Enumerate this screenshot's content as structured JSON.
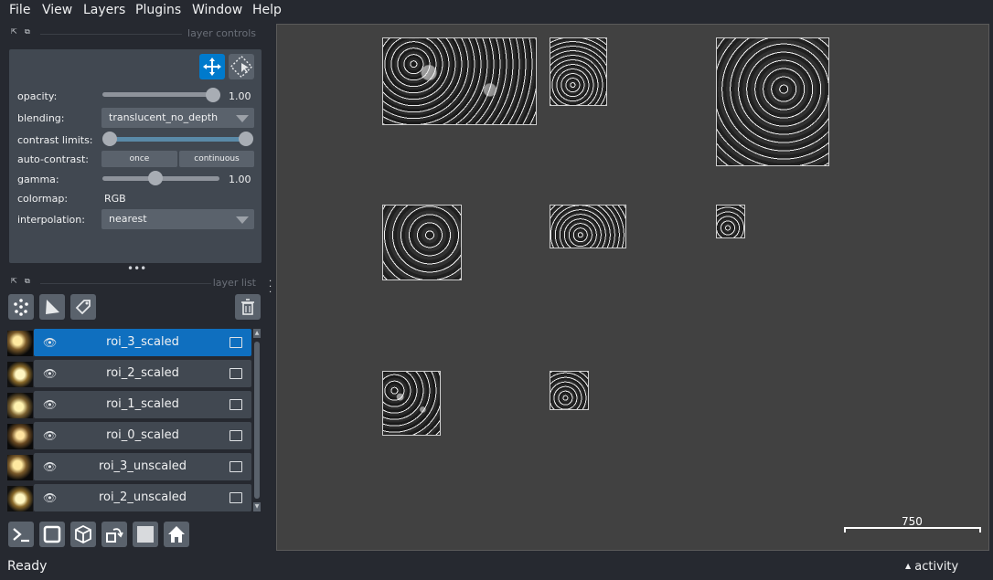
{
  "menu": {
    "file": "File",
    "view": "View",
    "layers": "Layers",
    "plugins": "Plugins",
    "window": "Window",
    "help": "Help"
  },
  "layer_controls": {
    "title": "layer controls",
    "opacity_label": "opacity:",
    "opacity_value": "1.00",
    "opacity_fraction": 1.0,
    "blending_label": "blending:",
    "blending_value": "translucent_no_depth",
    "contrast_label": "contrast limits:",
    "auto_contrast_label": "auto-contrast:",
    "once_label": "once",
    "continuous_label": "continuous",
    "gamma_label": "gamma:",
    "gamma_value": "1.00",
    "colormap_label": "colormap:",
    "colormap_value": "RGB",
    "interpolation_label": "interpolation:",
    "interpolation_value": "nearest"
  },
  "layer_list": {
    "title": "layer list",
    "layers": [
      {
        "name": "roi_3_scaled",
        "selected": true
      },
      {
        "name": "roi_2_scaled",
        "selected": false
      },
      {
        "name": "roi_1_scaled",
        "selected": false
      },
      {
        "name": "roi_0_scaled",
        "selected": false
      },
      {
        "name": "roi_3_unscaled",
        "selected": false
      },
      {
        "name": "roi_2_unscaled",
        "selected": false
      }
    ]
  },
  "canvas": {
    "scale_bar_label": "750"
  },
  "status": {
    "ready": "Ready",
    "activity": "activity"
  },
  "colors": {
    "accent": "#007acc",
    "selected_layer": "#0f6fbf",
    "panel": "#414851",
    "background": "#262930",
    "canvas": "#414141"
  }
}
